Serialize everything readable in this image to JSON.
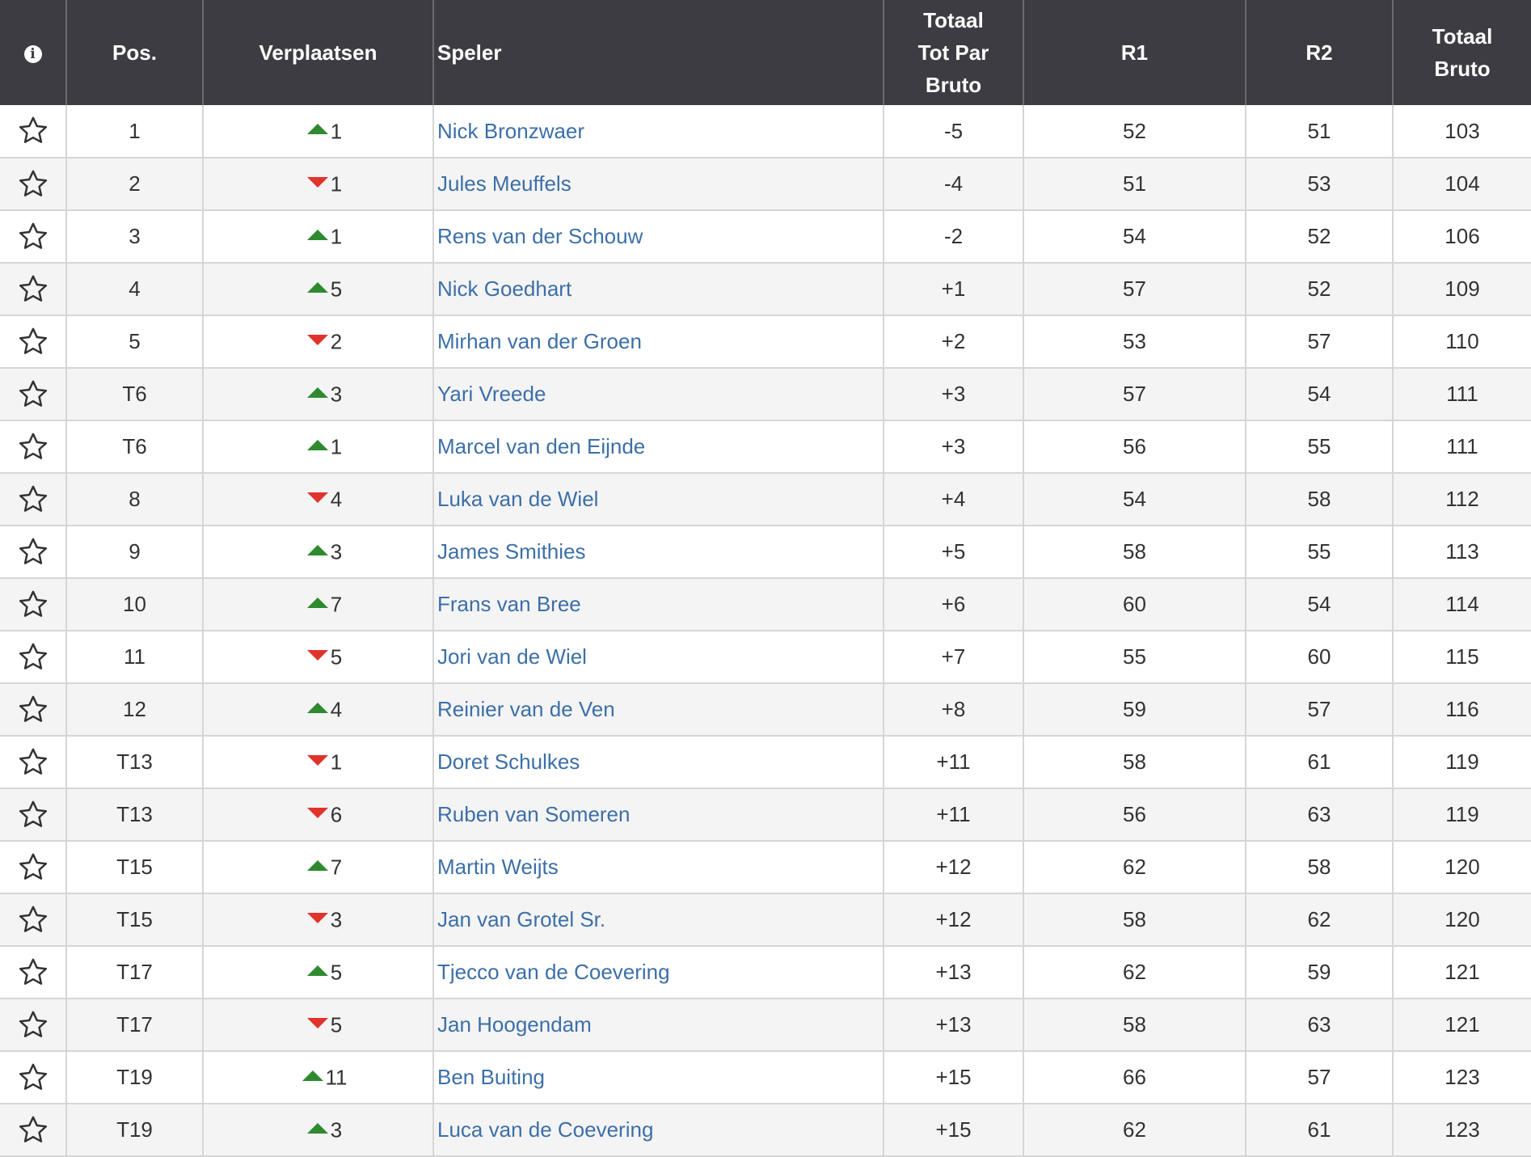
{
  "colors": {
    "header_bg": "#3d3c42",
    "link": "#3c6fa8",
    "arrow_up": "#2f8a2f",
    "arrow_down": "#e0332c",
    "row_alt": "#f4f4f4"
  },
  "header": {
    "info_icon": "i",
    "pos": "Pos.",
    "move": "Verplaatsen",
    "player": "Speler",
    "topar_line1": "Totaal",
    "topar_line2": "Tot Par",
    "topar_line3": "Bruto",
    "r1": "R1",
    "r2": "R2",
    "total_line1": "Totaal",
    "total_line2": "Bruto"
  },
  "rows": [
    {
      "pos": "1",
      "dir": "up",
      "move": "1",
      "player": "Nick Bronzwaer",
      "topar": "-5",
      "r1": "52",
      "r2": "51",
      "total": "103"
    },
    {
      "pos": "2",
      "dir": "down",
      "move": "1",
      "player": "Jules Meuffels",
      "topar": "-4",
      "r1": "51",
      "r2": "53",
      "total": "104"
    },
    {
      "pos": "3",
      "dir": "up",
      "move": "1",
      "player": "Rens van der Schouw",
      "topar": "-2",
      "r1": "54",
      "r2": "52",
      "total": "106"
    },
    {
      "pos": "4",
      "dir": "up",
      "move": "5",
      "player": "Nick Goedhart",
      "topar": "+1",
      "r1": "57",
      "r2": "52",
      "total": "109"
    },
    {
      "pos": "5",
      "dir": "down",
      "move": "2",
      "player": "Mirhan van der Groen",
      "topar": "+2",
      "r1": "53",
      "r2": "57",
      "total": "110"
    },
    {
      "pos": "T6",
      "dir": "up",
      "move": "3",
      "player": "Yari Vreede",
      "topar": "+3",
      "r1": "57",
      "r2": "54",
      "total": "111"
    },
    {
      "pos": "T6",
      "dir": "up",
      "move": "1",
      "player": "Marcel van den Eijnde",
      "topar": "+3",
      "r1": "56",
      "r2": "55",
      "total": "111"
    },
    {
      "pos": "8",
      "dir": "down",
      "move": "4",
      "player": "Luka van de Wiel",
      "topar": "+4",
      "r1": "54",
      "r2": "58",
      "total": "112"
    },
    {
      "pos": "9",
      "dir": "up",
      "move": "3",
      "player": "James Smithies",
      "topar": "+5",
      "r1": "58",
      "r2": "55",
      "total": "113"
    },
    {
      "pos": "10",
      "dir": "up",
      "move": "7",
      "player": "Frans van Bree",
      "topar": "+6",
      "r1": "60",
      "r2": "54",
      "total": "114"
    },
    {
      "pos": "11",
      "dir": "down",
      "move": "5",
      "player": "Jori van de Wiel",
      "topar": "+7",
      "r1": "55",
      "r2": "60",
      "total": "115"
    },
    {
      "pos": "12",
      "dir": "up",
      "move": "4",
      "player": "Reinier van de Ven",
      "topar": "+8",
      "r1": "59",
      "r2": "57",
      "total": "116"
    },
    {
      "pos": "T13",
      "dir": "down",
      "move": "1",
      "player": "Doret Schulkes",
      "topar": "+11",
      "r1": "58",
      "r2": "61",
      "total": "119"
    },
    {
      "pos": "T13",
      "dir": "down",
      "move": "6",
      "player": "Ruben van Someren",
      "topar": "+11",
      "r1": "56",
      "r2": "63",
      "total": "119"
    },
    {
      "pos": "T15",
      "dir": "up",
      "move": "7",
      "player": "Martin Weijts",
      "topar": "+12",
      "r1": "62",
      "r2": "58",
      "total": "120"
    },
    {
      "pos": "T15",
      "dir": "down",
      "move": "3",
      "player": "Jan van Grotel Sr.",
      "topar": "+12",
      "r1": "58",
      "r2": "62",
      "total": "120"
    },
    {
      "pos": "T17",
      "dir": "up",
      "move": "5",
      "player": "Tjecco van de Coevering",
      "topar": "+13",
      "r1": "62",
      "r2": "59",
      "total": "121"
    },
    {
      "pos": "T17",
      "dir": "down",
      "move": "5",
      "player": "Jan Hoogendam",
      "topar": "+13",
      "r1": "58",
      "r2": "63",
      "total": "121"
    },
    {
      "pos": "T19",
      "dir": "up",
      "move": "11",
      "player": "Ben Buiting",
      "topar": "+15",
      "r1": "66",
      "r2": "57",
      "total": "123"
    },
    {
      "pos": "T19",
      "dir": "up",
      "move": "3",
      "player": "Luca van de Coevering",
      "topar": "+15",
      "r1": "62",
      "r2": "61",
      "total": "123"
    }
  ]
}
